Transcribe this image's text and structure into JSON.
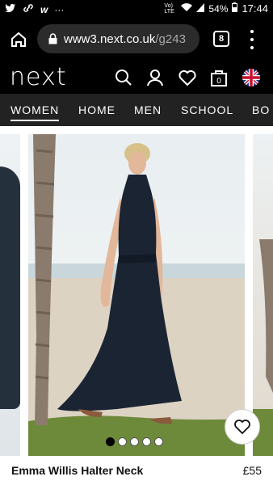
{
  "status_bar": {
    "volte": "Vo) LTE",
    "battery": "54%",
    "time": "17:44"
  },
  "browser": {
    "url_host": "www3.next.co.uk",
    "url_path": "/g243",
    "tab_count": "8"
  },
  "site": {
    "logo": "next",
    "nav": [
      "WOMEN",
      "HOME",
      "MEN",
      "SCHOOL",
      "BO"
    ],
    "active_nav": "WOMEN"
  },
  "carousel": {
    "slide_count": 5,
    "active_slide": 1
  },
  "product": {
    "name": "Emma Willis Halter Neck",
    "price": "£55"
  },
  "colors": {
    "chrome": "#000000",
    "nav_bg": "#222222",
    "accent": "#ffffff"
  }
}
